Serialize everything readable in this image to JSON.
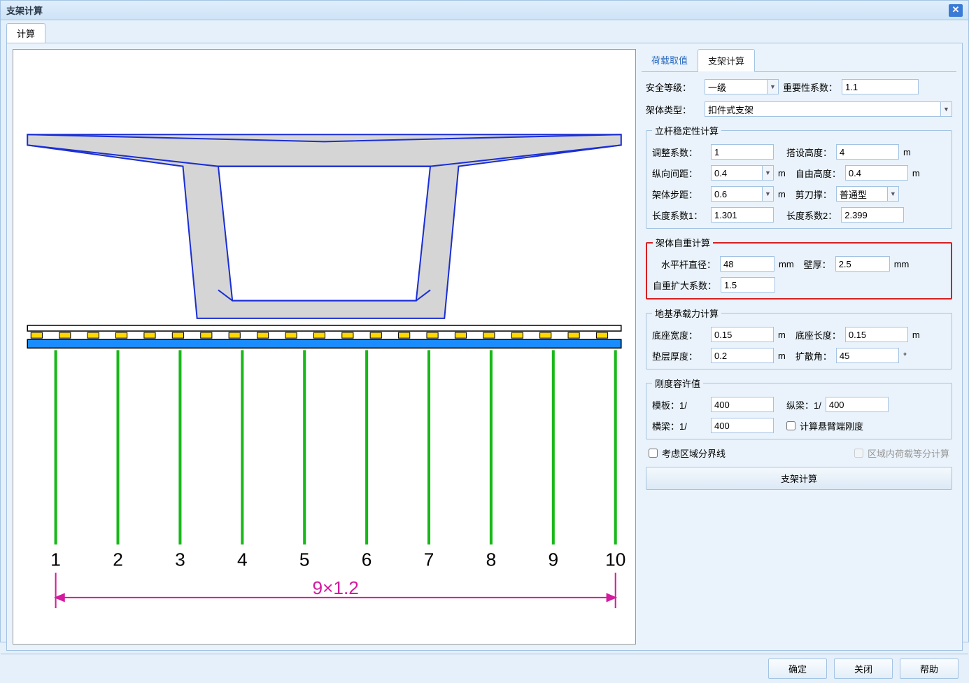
{
  "window": {
    "title": "支架计算"
  },
  "main_tab": "计算",
  "sidebar": {
    "tab1": "荷载取值",
    "tab2": "支架计算"
  },
  "top_row": {
    "safety_label": "安全等级：",
    "safety_value": "一级",
    "importance_label": "重要性系数：",
    "importance_value": "1.1",
    "frame_type_label": "架体类型：",
    "frame_type_value": "扣件式支架"
  },
  "stability": {
    "legend": "立杆稳定性计算",
    "adj_coef_label": "调整系数：",
    "adj_coef_value": "1",
    "erect_h_label": "搭设高度：",
    "erect_h_value": "4",
    "long_spacing_label": "纵向间距：",
    "long_spacing_value": "0.4",
    "free_h_label": "自由高度：",
    "free_h_value": "0.4",
    "step_label": "架体步距：",
    "step_value": "0.6",
    "brace_label": "剪刀撑：",
    "brace_value": "普通型",
    "len1_label": "长度系数1：",
    "len1_value": "1.301",
    "len2_label": "长度系数2：",
    "len2_value": "2.399"
  },
  "selfweight": {
    "legend": "架体自重计算",
    "hbar_d_label": "水平杆直径：",
    "hbar_d_value": "48",
    "wall_t_label": "壁厚：",
    "wall_t_value": "2.5",
    "amp_label": "自重扩大系数：",
    "amp_value": "1.5"
  },
  "foundation": {
    "legend": "地基承载力计算",
    "base_w_label": "底座宽度：",
    "base_w_value": "0.15",
    "base_l_label": "底座长度：",
    "base_l_value": "0.15",
    "pad_t_label": "垫层厚度：",
    "pad_t_value": "0.2",
    "spread_label": "扩散角：",
    "spread_value": "45"
  },
  "stiffness": {
    "legend": "刚度容许值",
    "formwork_label": "模板：1/",
    "formwork_value": "400",
    "longbeam_label": "纵梁：1/",
    "longbeam_value": "400",
    "crossbeam_label": "横梁：1/",
    "crossbeam_value": "400",
    "cantilever_cb": "计算悬臂端刚度"
  },
  "cb_area": "考虑区域分界线",
  "cb_load_equal": "区域内荷载等分计算",
  "calc_button": "支架计算",
  "diagram": {
    "supports": [
      "1",
      "2",
      "3",
      "4",
      "5",
      "6",
      "7",
      "8",
      "9",
      "10"
    ],
    "dim_text": "9×1.2"
  },
  "units": {
    "m": "m",
    "mm": "mm",
    "deg": "°"
  },
  "footer": {
    "ok": "确定",
    "close": "关闭",
    "help": "帮助"
  }
}
